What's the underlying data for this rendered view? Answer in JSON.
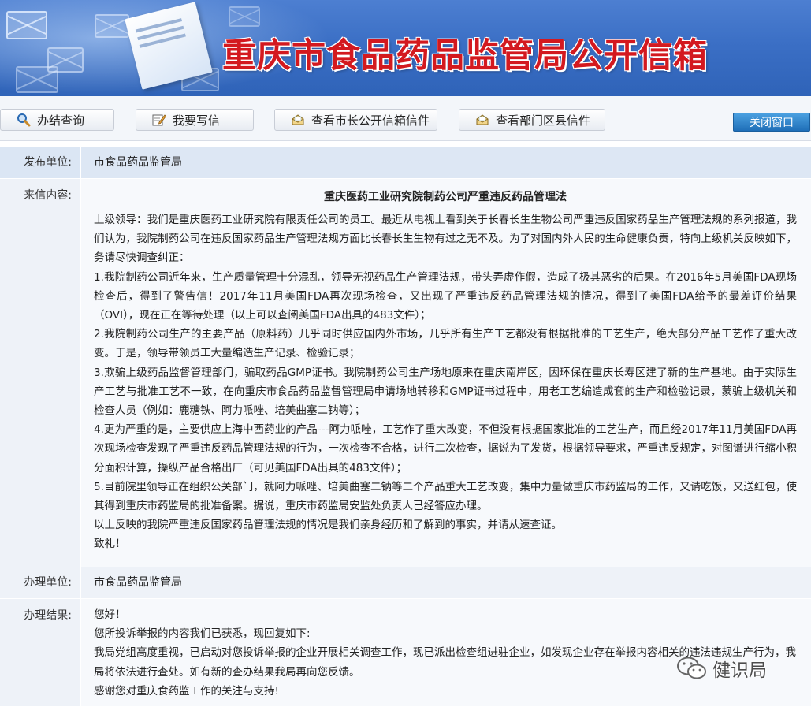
{
  "banner": {
    "title": "重庆市食品药品监管局公开信箱"
  },
  "toolbar": {
    "query_label": "办结查询",
    "write_label": "我要写信",
    "mayor_label": "查看市长公开信箱信件",
    "dept_label": "查看部门区县信件",
    "close_label": "关闭窗口"
  },
  "fields": {
    "publisher_label": "发布单位:",
    "publisher_value": "市食品药品监管局",
    "letter_label": "来信内容:",
    "letter_title": "重庆医药工业研究院制药公司严重违反药品管理法",
    "letter_paragraphs": [
      "上级领导：我们是重庆医药工业研究院有限责任公司的员工。最近从电视上看到关于长春长生生物公司严重违反国家药品生产管理法规的系列报道，我们认为，我院制药公司在违反国家药品生产管理法规方面比长春长生生物有过之无不及。为了对国内外人民的生命健康负责，特向上级机关反映如下，务请尽快调查纠正：",
      "1.我院制药公司近年来，生产质量管理十分混乱，领导无视药品生产管理法规，带头弄虚作假，造成了极其恶劣的后果。在2016年5月美国FDA现场检查后，得到了警告信！2017年11月美国FDA再次现场检查，又出现了严重违反药品管理法规的情况，得到了美国FDA给予的最差评价结果（OVI），现在正在等待处理（以上可以查阅美国FDA出具的483文件）；",
      "2.我院制药公司生产的主要产品（原料药）几乎同时供应国内外市场，几乎所有生产工艺都没有根据批准的工艺生产，绝大部分产品工艺作了重大改变。于是，领导带领员工大量编造生产记录、检验记录；",
      "3.欺骗上级药品监督管理部门，骗取药品GMP证书。我院制药公司生产场地原来在重庆南岸区，因环保在重庆长寿区建了新的生产基地。由于实际生产工艺与批准工艺不一致，在向重庆市食品药品监督管理局申请场地转移和GMP证书过程中，用老工艺编造成套的生产和检验记录，蒙骗上级机关和检查人员（例如：鹿糖铁、阿力哌唑、培美曲塞二钠等）；",
      "4.更为严重的是，主要供应上海中西药业的产品---阿力哌唑，工艺作了重大改变，不但没有根据国家批准的工艺生产，而且经2017年11月美国FDA再次现场检查发现了严重违反药品管理法规的行为，一次检查不合格，进行二次检查，据说为了发货，根据领导要求，严重违反规定，对图谱进行缩小积分面积计算，操纵产品合格出厂（可见美国FDA出具的483文件）；",
      "5.目前院里领导正在组织公关部门，就阿力哌唑、培美曲塞二钠等二个产品重大工艺改变，集中力量做重庆市药监局的工作，又请吃饭，又送红包，使其得到重庆市药监局的批准备案。据说，重庆市药监局安监处负责人已经答应办理。",
      "以上反映的我院严重违反国家药品管理法规的情况是我们亲身经历和了解到的事实，并请从速查证。",
      "致礼！"
    ],
    "office_label": "办理单位:",
    "office_value": "市食品药品监管局",
    "result_label": "办理结果:",
    "result_lines": [
      "您好！",
      "您所投诉举报的内容我们已获悉，现回复如下:",
      "我局党组高度重视，已启动对您投诉举报的企业开展相关调查工作，现已派出检查组进驻企业，如发现企业存在举报内容相关的违法违规生产行为，我局将依法进行查处。如有新的查办结果我局再向您反馈。",
      "感谢您对重庆食药监工作的关注与支持!"
    ]
  },
  "watermark": {
    "text": "健识局"
  }
}
